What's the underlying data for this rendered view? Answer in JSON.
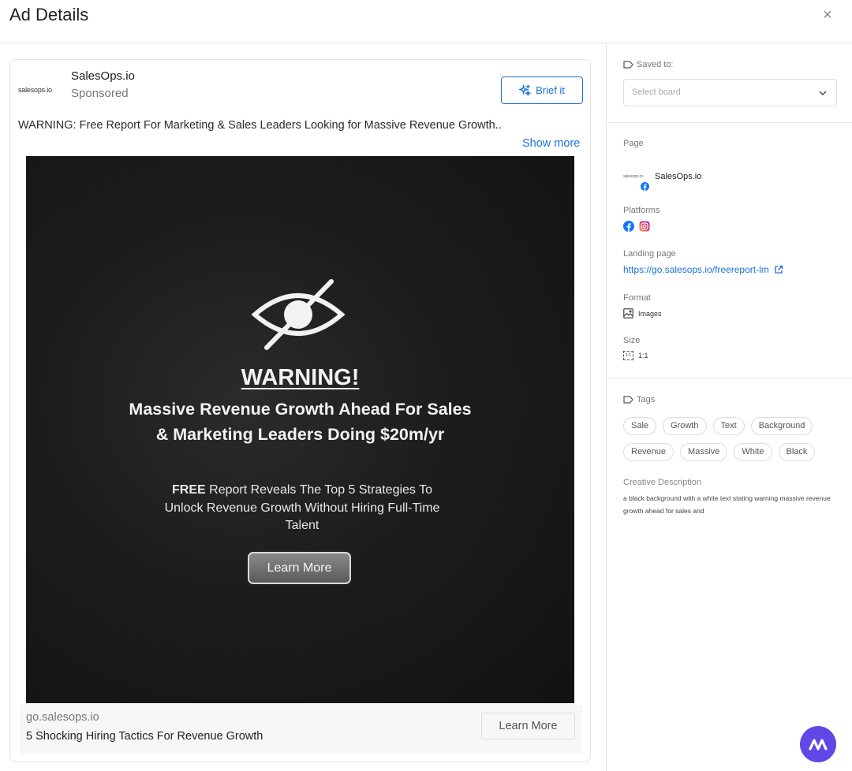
{
  "header": {
    "title": "Ad Details",
    "close_label": "×"
  },
  "ad": {
    "logo_text": "salesops.io",
    "brand": "SalesOps.io",
    "sponsored": "Sponsored",
    "brief_label": "Brief it",
    "text": "WARNING: Free Report For Marketing & Sales Leaders Looking for Massive Revenue Growth..",
    "show_more": "Show more",
    "creative": {
      "warning": "WARNING!",
      "headline": "Massive Revenue Growth Ahead For Sales & Marketing Leaders Doing $20m/yr",
      "sub_bold": "FREE",
      "sub_rest": " Report Reveals The Top 5 Strategies To Unlock Revenue Growth Without Hiring Full-Time Talent",
      "cta": "Learn More"
    },
    "footer": {
      "domain": "go.salesops.io",
      "headline": "5 Shocking Hiring Tactics For Revenue Growth",
      "cta": "Learn More"
    }
  },
  "sidebar": {
    "saved_label": "Saved to:",
    "select_placeholder": "Select board",
    "page_label": "Page",
    "page_logo_text": "salesops.io",
    "page_name": "SalesOps.io",
    "platforms_label": "Platforms",
    "platforms": [
      "facebook-icon",
      "instagram-icon"
    ],
    "landing_label": "Landing page",
    "landing_url": "https://go.salesops.io/freereport-lm",
    "format_label": "Format",
    "format_value": "Images",
    "size_label": "Size",
    "size_value": "1:1",
    "size_icon_text": "1:1",
    "tags_label": "Tags",
    "tags": [
      "Sale",
      "Growth",
      "Text",
      "Background",
      "Revenue",
      "Massive",
      "White",
      "Black"
    ],
    "desc_label": "Creative Description",
    "desc": "a black background with a white text stating warning massive revenue growth ahead for sales and"
  },
  "colors": {
    "accent": "#1a73d9",
    "fab": "#6048e6",
    "facebook": "#1877f2"
  }
}
